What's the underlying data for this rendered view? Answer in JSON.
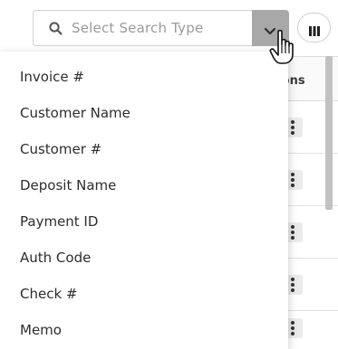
{
  "search": {
    "placeholder": "Select Search Type"
  },
  "table": {
    "actions_header": "tions"
  },
  "dropdown": {
    "items": [
      "Invoice #",
      "Customer Name",
      "Customer #",
      "Deposit Name",
      "Payment ID",
      "Auth Code",
      "Check #",
      "Memo"
    ]
  },
  "icons": {
    "search": "search-icon",
    "chevron": "chevron-down-icon",
    "columns": "columns-icon",
    "cursor": "hand-cursor-icon",
    "row_actions": "kebab-menu-icon"
  },
  "colors": {
    "toggle_bg": "#a8a8a8",
    "menu_text": "#2d2d2d",
    "placeholder_text": "#9a9a9a"
  }
}
